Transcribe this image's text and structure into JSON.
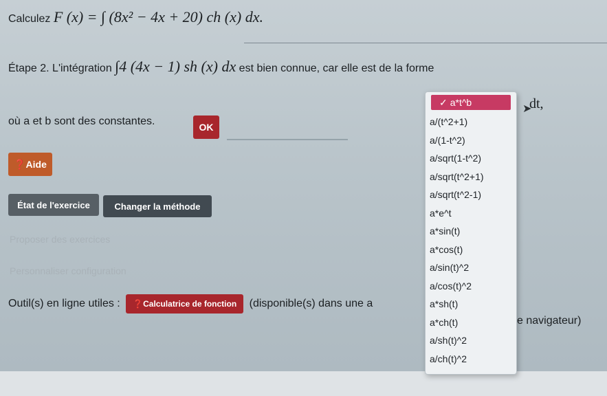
{
  "question": {
    "prefix": "Calculez",
    "formula_lhs": "F (x) = ∫ (8x² − 4x + 20) ch (x) dx."
  },
  "step": {
    "label": "Étape 2. L'intégration",
    "formula": "∫4 (4x − 1) sh (x) dx",
    "suffix": "est bien connue, car elle est de la forme"
  },
  "continuation": {
    "text": "où a et b sont des constantes.",
    "dt": "dt,"
  },
  "buttons": {
    "ok": "OK",
    "aide": "❓Aide",
    "etat": "État de l'exercice",
    "methode": "Changer la méthode"
  },
  "faded_items": [
    "Proposer des exercices",
    "Personnaliser configuration"
  ],
  "tools": {
    "label": "Outil(s) en ligne utiles :",
    "calc_button": "❓Calculatrice de fonction",
    "after": "(disponible(s) dans une a",
    "tail": "e navigateur)"
  },
  "dropdown": {
    "selected": "a*t^b",
    "options": [
      "a/(t^2+1)",
      "a/(1-t^2)",
      "a/sqrt(1-t^2)",
      "a/sqrt(t^2+1)",
      "a/sqrt(t^2-1)",
      "a*e^t",
      "a*sin(t)",
      "a*cos(t)",
      "a/sin(t)^2",
      "a/cos(t)^2",
      "a*sh(t)",
      "a*ch(t)",
      "a/sh(t)^2",
      "a/ch(t)^2"
    ]
  },
  "colors": {
    "accent_red": "#a8262c",
    "selected_pink": "#c73a63",
    "help_orange": "#bf5b2a"
  }
}
